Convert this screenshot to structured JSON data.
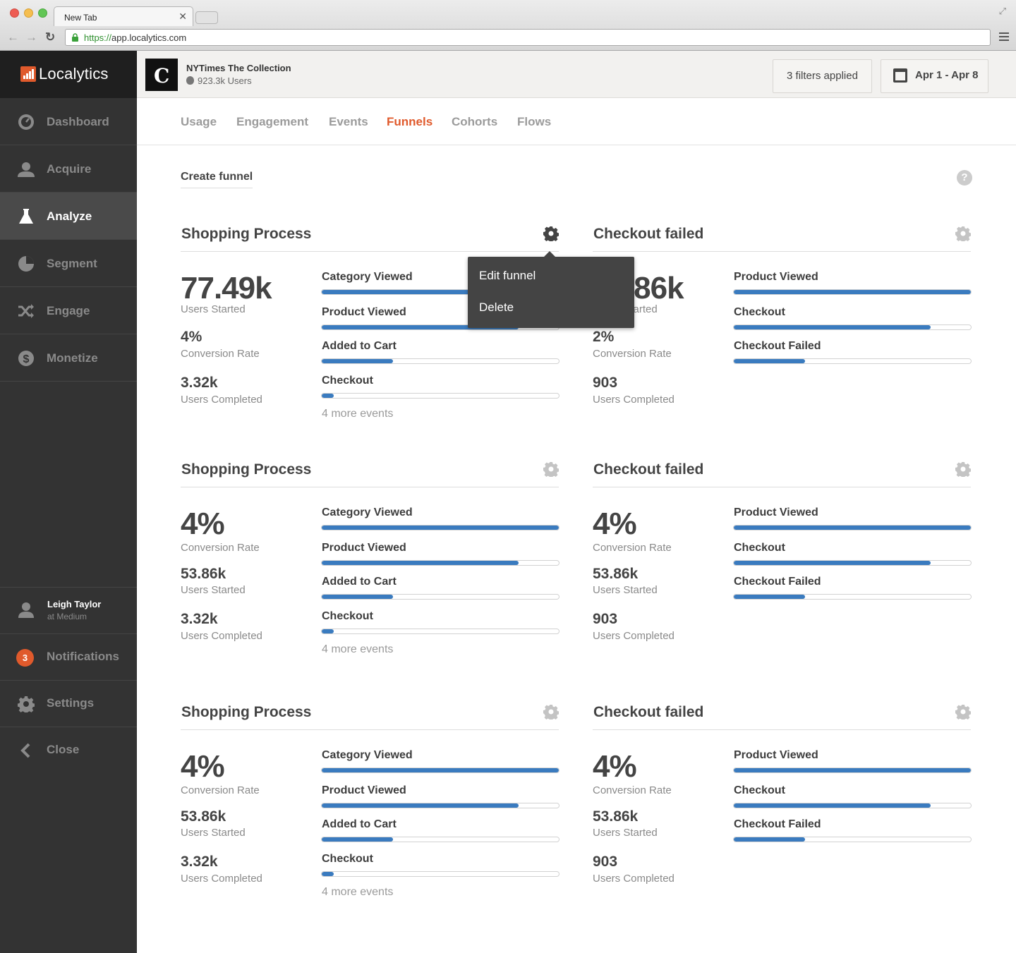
{
  "browser": {
    "tab_title": "New Tab",
    "url_scheme": "https://",
    "url_host": "app.localytics.com"
  },
  "sidebar": {
    "brand": "Localytics",
    "items": [
      {
        "label": "Dashboard",
        "icon": "gauge-icon",
        "active": false
      },
      {
        "label": "Acquire",
        "icon": "user-icon",
        "active": false
      },
      {
        "label": "Analyze",
        "icon": "flask-icon",
        "active": true
      },
      {
        "label": "Segment",
        "icon": "pie-icon",
        "active": false
      },
      {
        "label": "Engage",
        "icon": "shuffle-icon",
        "active": false
      },
      {
        "label": "Monetize",
        "icon": "dollar-icon",
        "active": false
      }
    ],
    "user": {
      "name": "Leigh Taylor",
      "org": "at Medium"
    },
    "notifications": {
      "label": "Notifications",
      "count": "3"
    },
    "settings_label": "Settings",
    "close_label": "Close"
  },
  "app": {
    "name": "NYTimes The Collection",
    "users": "923.3k Users",
    "filters": "3 filters applied",
    "date_range": "Apr 1 - Apr 8"
  },
  "tabs": [
    {
      "label": "Usage",
      "active": false
    },
    {
      "label": "Engagement",
      "active": false
    },
    {
      "label": "Events",
      "active": false
    },
    {
      "label": "Funnels",
      "active": true
    },
    {
      "label": "Cohorts",
      "active": false
    },
    {
      "label": "Flows",
      "active": false
    }
  ],
  "create_funnel": "Create funnel",
  "help": "?",
  "menu": {
    "edit": "Edit funnel",
    "delete": "Delete"
  },
  "funnels": [
    {
      "title": "Shopping Process",
      "stats": [
        {
          "value": "77.49k",
          "label": "Users Started"
        },
        {
          "value": "4%",
          "label": "Conversion Rate"
        },
        {
          "value": "3.32k",
          "label": "Users Completed"
        }
      ],
      "events": [
        {
          "label": "Category Viewed",
          "progress": 1.0
        },
        {
          "label": "Product Viewed",
          "progress": 0.83
        },
        {
          "label": "Added to Cart",
          "progress": 0.3
        },
        {
          "label": "Checkout",
          "progress": 0.05
        }
      ],
      "more": "4 more events"
    },
    {
      "title": "Checkout failed",
      "stats": [
        {
          "value": "53.86k",
          "label": "Users Started"
        },
        {
          "value": "2%",
          "label": "Conversion Rate"
        },
        {
          "value": "903",
          "label": "Users Completed"
        }
      ],
      "events": [
        {
          "label": "Product Viewed",
          "progress": 1.0
        },
        {
          "label": "Checkout",
          "progress": 0.83
        },
        {
          "label": "Checkout Failed",
          "progress": 0.3
        }
      ],
      "more": ""
    },
    {
      "title": "Shopping Process",
      "stats": [
        {
          "value": "4%",
          "label": "Conversion Rate"
        },
        {
          "value": "53.86k",
          "label": "Users Started"
        },
        {
          "value": "3.32k",
          "label": "Users Completed"
        }
      ],
      "events": [
        {
          "label": "Category Viewed",
          "progress": 1.0
        },
        {
          "label": "Product Viewed",
          "progress": 0.83
        },
        {
          "label": "Added to Cart",
          "progress": 0.3
        },
        {
          "label": "Checkout",
          "progress": 0.05
        }
      ],
      "more": "4 more events"
    },
    {
      "title": "Checkout failed",
      "stats": [
        {
          "value": "4%",
          "label": "Conversion Rate"
        },
        {
          "value": "53.86k",
          "label": "Users Started"
        },
        {
          "value": "903",
          "label": "Users Completed"
        }
      ],
      "events": [
        {
          "label": "Product Viewed",
          "progress": 1.0
        },
        {
          "label": "Checkout",
          "progress": 0.83
        },
        {
          "label": "Checkout Failed",
          "progress": 0.3
        }
      ],
      "more": ""
    },
    {
      "title": "Shopping Process",
      "stats": [
        {
          "value": "4%",
          "label": "Conversion Rate"
        },
        {
          "value": "53.86k",
          "label": "Users Started"
        },
        {
          "value": "3.32k",
          "label": "Users Completed"
        }
      ],
      "events": [
        {
          "label": "Category Viewed",
          "progress": 1.0
        },
        {
          "label": "Product Viewed",
          "progress": 0.83
        },
        {
          "label": "Added to Cart",
          "progress": 0.3
        },
        {
          "label": "Checkout",
          "progress": 0.05
        }
      ],
      "more": "4 more events"
    },
    {
      "title": "Checkout failed",
      "stats": [
        {
          "value": "4%",
          "label": "Conversion Rate"
        },
        {
          "value": "53.86k",
          "label": "Users Started"
        },
        {
          "value": "903",
          "label": "Users Completed"
        }
      ],
      "events": [
        {
          "label": "Product Viewed",
          "progress": 1.0
        },
        {
          "label": "Checkout",
          "progress": 0.83
        },
        {
          "label": "Checkout Failed",
          "progress": 0.3
        }
      ],
      "more": ""
    }
  ]
}
